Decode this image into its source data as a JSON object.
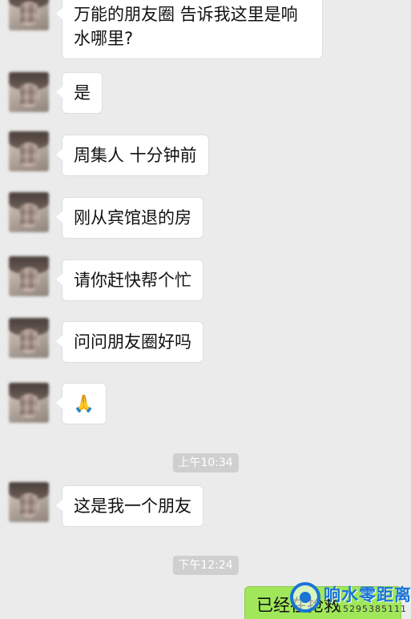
{
  "messages": [
    {
      "text": "万能的朋友圈 告诉我这里是响水哪里?"
    },
    {
      "text": "是"
    },
    {
      "text": "周集人 十分钟前"
    },
    {
      "text": "刚从宾馆退的房"
    },
    {
      "text": "请你赶快帮个忙"
    },
    {
      "text": "问问朋友圈好吗"
    },
    {
      "text": "🙏"
    },
    {
      "text": "这是我一个朋友"
    }
  ],
  "timestamps": [
    "上午10:34",
    "下午12:24"
  ],
  "my_message": {
    "text": "已经在抢救"
  },
  "watermark": {
    "name": "响水零距离",
    "phone": "15295385111"
  },
  "colors": {
    "background": "#ebebeb",
    "my_bubble": "#a0e75a",
    "watermark": "#1a74d6"
  }
}
